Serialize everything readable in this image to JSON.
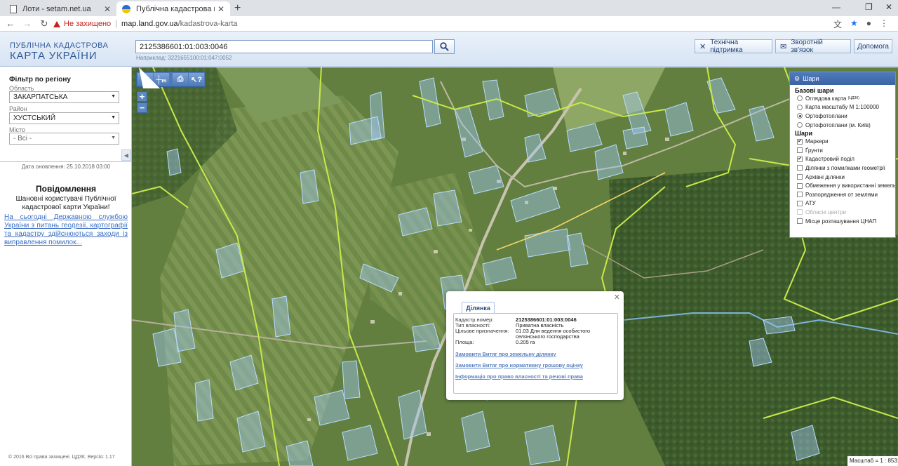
{
  "browser": {
    "tabs": [
      {
        "title": "Лоти - setam.net.ua",
        "active": false
      },
      {
        "title": "Публічна кадастрова карта Укр",
        "active": true
      }
    ],
    "security_label": "Не захищено",
    "url_host": "map.land.gov.ua",
    "url_path": "/kadastrova-karta"
  },
  "header": {
    "logo_line1": "ПУБЛІЧНА КАДАСТРОВА",
    "logo_line2": "КАРТА УКРАЇНИ",
    "search_value": "2125386601:01:003:0046",
    "search_hint": "Наприклад: 3221655100:01:047:0052",
    "buttons": {
      "support": "Технічна підтримка",
      "feedback": "Зворотній зв'язок",
      "help": "Допомога"
    }
  },
  "filter": {
    "title": "Фільтр по регіону",
    "oblast_label": "Область",
    "oblast_value": "ЗАКАРПАТСЬКА",
    "rayon_label": "Район",
    "rayon_value": "ХУСТСЬКИЙ",
    "city_label": "Місто",
    "city_value": "- Всі -"
  },
  "update_date": "Дата оновлення: 25.10.2018 03:00",
  "notice": {
    "title": "Повідомлення",
    "greeting": "Шановні користувачі Публічної кадастрової карти України!",
    "link_text": "На сьогодні Державною службою України з питань геодезії, картографії та кадастру здійснюються заходи із виправлення помилок..."
  },
  "copyright": "© 2016 Всі права захищені. ЦДЗК. Версія: 1.17",
  "layers": {
    "title": "Шари",
    "base_title": "Базові шари",
    "base": [
      {
        "label": "Оглядова карта",
        "sup": "(ЦДЗК)",
        "selected": false
      },
      {
        "label": "Карта масштабу М 1:100000",
        "sup": "",
        "selected": false
      },
      {
        "label": "Ортофотоплани",
        "sup": "",
        "selected": true
      },
      {
        "label": "Ортофотоплани (м. Київ)",
        "sup": "",
        "selected": false
      }
    ],
    "overlay_title": "Шари",
    "overlays": [
      {
        "label": "Маркери",
        "checked": true,
        "disabled": false
      },
      {
        "label": "Ґрунти",
        "checked": false,
        "disabled": false
      },
      {
        "label": "Кадастровий поділ",
        "checked": true,
        "disabled": false
      },
      {
        "label": "Ділянки з помилками геометрії",
        "checked": false,
        "disabled": false
      },
      {
        "label": "Архівні ділянки",
        "checked": false,
        "disabled": false
      },
      {
        "label": "Обмеження у використанні земель",
        "checked": false,
        "disabled": false
      },
      {
        "label": "Розпорядження от землями",
        "checked": false,
        "disabled": false
      },
      {
        "label": "АТУ",
        "checked": false,
        "disabled": false
      },
      {
        "label": "Обласні центри",
        "checked": false,
        "disabled": true
      },
      {
        "label": "Місце розташування ЦНАП",
        "checked": false,
        "disabled": false
      }
    ]
  },
  "popup": {
    "tab": "Ділянка",
    "rows": [
      {
        "label": "Кадастр.номер:",
        "value": "2125386601:01:003:0046"
      },
      {
        "label": "Тип власності:",
        "value": "Приватна власність"
      },
      {
        "label": "Цільове призначення:",
        "value": "01.03 Для ведення особистого селянського господарства"
      },
      {
        "label": "Площа:",
        "value": "0.205 га"
      }
    ],
    "links": [
      "Замовити Витяг про земельну ділянку",
      "Замовити Витяг про нормативну грошову оцінку",
      "Інформація про право власності та речові права"
    ]
  },
  "scale": "Масштаб = 1 : 8531",
  "colors": {
    "accent": "#3a63a3",
    "parcel_fill": "#9fc7f0",
    "boundary": "#c9e84a"
  }
}
